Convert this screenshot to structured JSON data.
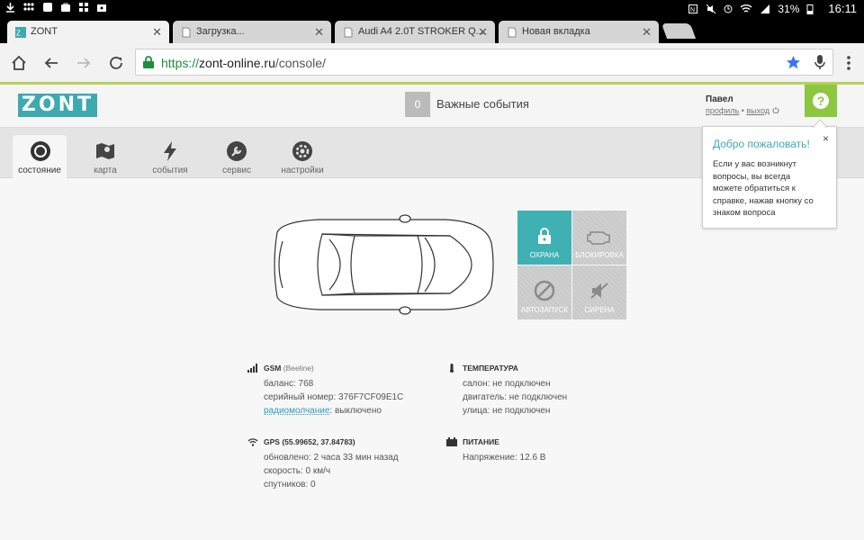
{
  "statusbar": {
    "battery": "31%",
    "time": "16:11"
  },
  "tabs": [
    {
      "label": "ZONT"
    },
    {
      "label": "Загрузка..."
    },
    {
      "label": "Audi A4 2.0T STROKER Q..."
    },
    {
      "label": "Новая вкладка"
    }
  ],
  "omnibox": {
    "scheme": "https://",
    "host": "zont-online.ru",
    "path": "/console/"
  },
  "app": {
    "logo": "ZONT",
    "events_count": "0",
    "events_label": "Важные события",
    "user_name": "Павел",
    "profile_link": "профиль",
    "separator": "•",
    "logout_link": "выход",
    "help_icon": "?"
  },
  "welcome": {
    "title": "Добро пожаловать!",
    "text": "Если у вас возникнут вопросы, вы всегда можете обратиться к справке, нажав кнопку со знаком вопроса",
    "close": "×"
  },
  "nav": [
    {
      "label": "состояние",
      "icon": "status-icon"
    },
    {
      "label": "карта",
      "icon": "map-icon"
    },
    {
      "label": "события",
      "icon": "lightning-icon"
    },
    {
      "label": "сервис",
      "icon": "wrench-icon"
    },
    {
      "label": "настройки",
      "icon": "gear-icon"
    }
  ],
  "tiles": {
    "guard": "ОХРАНА",
    "block": "БЛОКИРОВКА",
    "autostart": "АВТОЗАПУСК",
    "siren": "СИРЕНА"
  },
  "gsm": {
    "title": "GSM",
    "operator": "(Beeline)",
    "balance": "баланс: 768",
    "serial": "серийный номер: 376F7CF09E1C",
    "radio_link": "радиомолчание",
    "radio_value": ": выключено"
  },
  "gps": {
    "title": "GPS",
    "coords": "(55.99652, 37.84783)",
    "updated": "обновлено: 2 часа 33 мин назад",
    "speed": "скорость: 0 км/ч",
    "satellites": "спутников: 0"
  },
  "temperature": {
    "title": "ТЕМПЕРАТУРА",
    "cabin": "салон: не подключен",
    "engine": "двигатель: не подключен",
    "street": "улица: не подключен"
  },
  "power": {
    "title": "ПИТАНИЕ",
    "voltage": "Напряжение: 12.6 В"
  },
  "colors": {
    "accent": "#3fa9b0",
    "help_green": "#8dc63f",
    "tile_on": "#3fb1b3",
    "tile_off": "#c9c9c9"
  }
}
